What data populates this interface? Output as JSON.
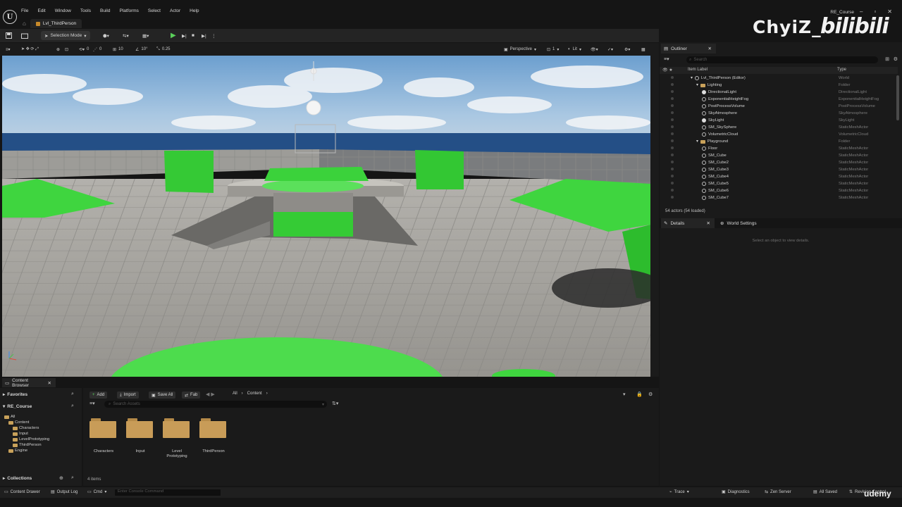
{
  "app": {
    "menu": [
      "File",
      "Edit",
      "Window",
      "Tools",
      "Build",
      "Platforms",
      "Select",
      "Actor",
      "Help"
    ],
    "project_name": "RE_Course",
    "level_tab": "Lvl_ThirdPerson",
    "watermark": "ChyiZ_",
    "watermark_brand": "bilibili"
  },
  "toolbar": {
    "selection_mode": "Selection Mode"
  },
  "viewport": {
    "snap_rotation": "10°",
    "snap_grid": "10",
    "scale_snap": "0.25",
    "angle_value": "0",
    "view_mode": "Perspective",
    "lit_mode": "Lit",
    "camera_speed": "1"
  },
  "outliner": {
    "tab_label": "Outliner",
    "search_placeholder": "Search",
    "col_label": "Item Label",
    "col_type": "Type",
    "rows": [
      {
        "label": "Lvl_ThirdPerson (Editor)",
        "type": "World",
        "indent": 0,
        "icon": "world"
      },
      {
        "label": "Lighting",
        "type": "Folder",
        "indent": 1,
        "icon": "folder"
      },
      {
        "label": "DirectionalLight",
        "type": "DirectionalLight",
        "indent": 2,
        "icon": "light"
      },
      {
        "label": "ExponentialHeightFog",
        "type": "ExponentialHeightFog",
        "indent": 2,
        "icon": "actor"
      },
      {
        "label": "PostProcessVolume",
        "type": "PostProcessVolume",
        "indent": 2,
        "icon": "actor"
      },
      {
        "label": "SkyAtmosphere",
        "type": "SkyAtmosphere",
        "indent": 2,
        "icon": "actor"
      },
      {
        "label": "SkyLight",
        "type": "SkyLight",
        "indent": 2,
        "icon": "light"
      },
      {
        "label": "SM_SkySphere",
        "type": "StaticMeshActor",
        "indent": 2,
        "icon": "actor"
      },
      {
        "label": "VolumetricCloud",
        "type": "VolumetricCloud",
        "indent": 2,
        "icon": "actor"
      },
      {
        "label": "Playground",
        "type": "Folder",
        "indent": 1,
        "icon": "folder"
      },
      {
        "label": "Floor",
        "type": "StaticMeshActor",
        "indent": 2,
        "icon": "actor"
      },
      {
        "label": "SM_Cube",
        "type": "StaticMeshActor",
        "indent": 2,
        "icon": "actor"
      },
      {
        "label": "SM_Cube2",
        "type": "StaticMeshActor",
        "indent": 2,
        "icon": "actor"
      },
      {
        "label": "SM_Cube3",
        "type": "StaticMeshActor",
        "indent": 2,
        "icon": "actor"
      },
      {
        "label": "SM_Cube4",
        "type": "StaticMeshActor",
        "indent": 2,
        "icon": "actor"
      },
      {
        "label": "SM_Cube5",
        "type": "StaticMeshActor",
        "indent": 2,
        "icon": "actor"
      },
      {
        "label": "SM_Cube6",
        "type": "StaticMeshActor",
        "indent": 2,
        "icon": "actor"
      },
      {
        "label": "SM_Cube7",
        "type": "StaticMeshActor",
        "indent": 2,
        "icon": "actor"
      }
    ],
    "actor_count": "54 actors (54 loaded)"
  },
  "details": {
    "tab_label": "Details",
    "world_settings_label": "World Settings",
    "empty_text": "Select an object to view details."
  },
  "content_browser": {
    "tab_label": "Content Browser",
    "favorites": "Favorites",
    "project": "RE_Course",
    "collections": "Collections",
    "tree": [
      {
        "label": "All",
        "indent": 0
      },
      {
        "label": "Content",
        "indent": 1
      },
      {
        "label": "Characters",
        "indent": 2
      },
      {
        "label": "Input",
        "indent": 2
      },
      {
        "label": "LevelPrototyping",
        "indent": 2
      },
      {
        "label": "ThirdPerson",
        "indent": 2
      },
      {
        "label": "Engine",
        "indent": 1
      }
    ],
    "add_label": "Add",
    "import_label": "Import",
    "save_all_label": "Save All",
    "fab_label": "Fab",
    "path": [
      "All",
      "Content"
    ],
    "search_placeholder": "Search Assets",
    "folders": [
      "Characters",
      "Input",
      "Level Prototyping",
      "ThirdPerson"
    ],
    "items_count": "4 items"
  },
  "statusbar": {
    "content_drawer": "Content Drawer",
    "output_log": "Output Log",
    "cmd": "Cmd",
    "console_placeholder": "Enter Console Command",
    "trace": "Trace",
    "diagnostics": "Diagnostics",
    "zen_server": "Zen Server",
    "all_saved": "All Saved",
    "revision_control": "Revision Control"
  },
  "overlay": {
    "udemy": "udemy"
  },
  "colors": {
    "accent_green": "#3ed63e",
    "sky_top": "#6a9ac8",
    "floor": "#a9a7a2",
    "folder": "#c89c58"
  }
}
